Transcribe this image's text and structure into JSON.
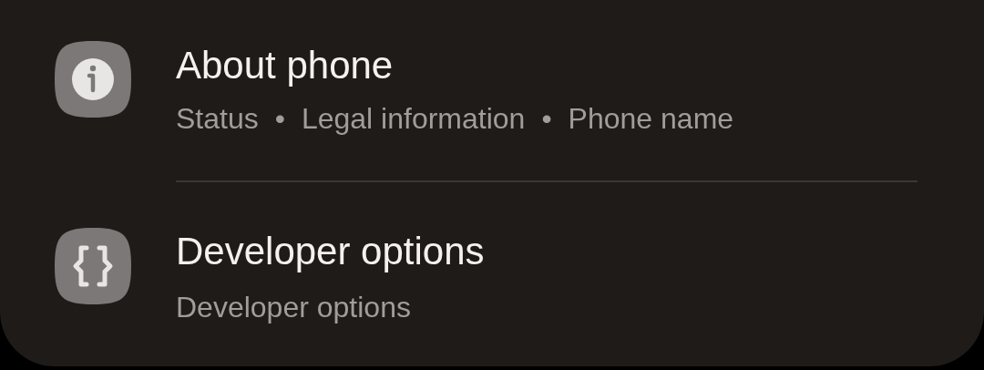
{
  "items": [
    {
      "kind": "info",
      "title": "About phone",
      "summary": [
        "Status",
        "Legal information",
        "Phone name"
      ],
      "separator": "•"
    },
    {
      "kind": "code",
      "title": "Developer options",
      "summary": [
        "Developer options"
      ]
    }
  ]
}
